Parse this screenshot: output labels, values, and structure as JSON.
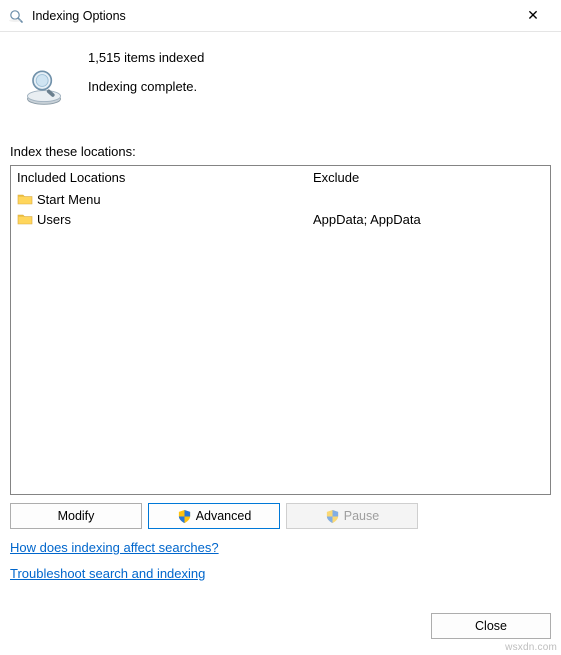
{
  "window": {
    "title": "Indexing Options",
    "close_glyph": "✕"
  },
  "status": {
    "count_line": "1,515 items indexed",
    "status_line": "Indexing complete."
  },
  "labels": {
    "index_locations": "Index these locations:"
  },
  "columns": {
    "included": "Included Locations",
    "exclude": "Exclude"
  },
  "locations": {
    "rows": [
      {
        "name": "Start Menu",
        "exclude": ""
      },
      {
        "name": "Users",
        "exclude": "AppData; AppData"
      }
    ]
  },
  "buttons": {
    "modify": "Modify",
    "advanced": "Advanced",
    "pause": "Pause",
    "close": "Close"
  },
  "links": {
    "howto": "How does indexing affect searches?",
    "troubleshoot": "Troubleshoot search and indexing"
  },
  "watermark": "wsxdn.com"
}
